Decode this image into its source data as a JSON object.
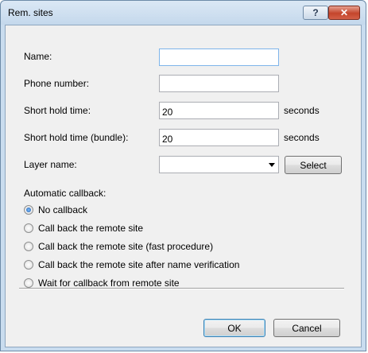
{
  "window": {
    "title": "Rem. sites",
    "help_label": "?",
    "close_label": "✕"
  },
  "fields": {
    "name": {
      "label": "Name:",
      "value": ""
    },
    "phone": {
      "label": "Phone number:",
      "value": ""
    },
    "short_hold": {
      "label": "Short hold time:",
      "value": "20",
      "unit": "seconds"
    },
    "short_hold_bundle": {
      "label": "Short hold time (bundle):",
      "value": "20",
      "unit": "seconds"
    },
    "layer": {
      "label": "Layer name:",
      "value": "",
      "select_label": "Select"
    }
  },
  "callback": {
    "label": "Automatic callback:",
    "options": [
      {
        "label": "No callback",
        "checked": true
      },
      {
        "label": "Call back the remote site",
        "checked": false
      },
      {
        "label": "Call back the remote site (fast procedure)",
        "checked": false
      },
      {
        "label": "Call back the remote site after name verification",
        "checked": false
      },
      {
        "label": "Wait for callback from remote site",
        "checked": false
      }
    ]
  },
  "buttons": {
    "ok": "OK",
    "cancel": "Cancel"
  }
}
